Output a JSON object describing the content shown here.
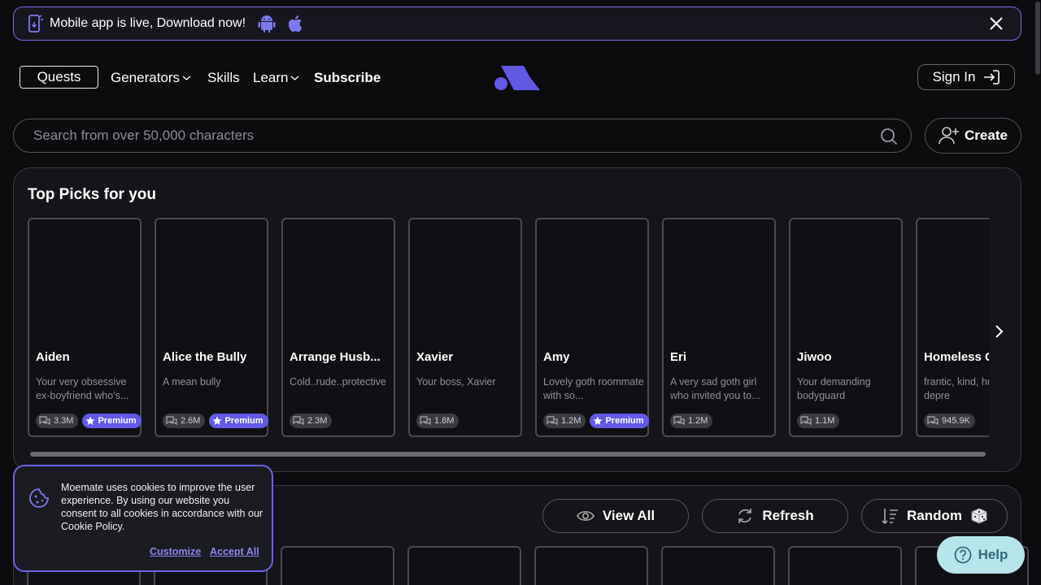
{
  "banner": {
    "text": "Mobile app is live, Download now!",
    "icons": [
      "phone-icon",
      "android-icon",
      "apple-icon",
      "close-icon"
    ]
  },
  "nav": {
    "quests": "Quests",
    "generators": "Generators",
    "skills": "Skills",
    "learn": "Learn",
    "subscribe": "Subscribe",
    "sign_in": "Sign In"
  },
  "search": {
    "placeholder": "Search from over 50,000 characters",
    "create_label": "Create"
  },
  "top_picks": {
    "title": "Top Picks for you",
    "premium_label": "Premium",
    "cards": [
      {
        "name": "Aiden",
        "desc": "Your very obsessive ex-boyfriend who's...",
        "count": "3.3M",
        "premium": true
      },
      {
        "name": "Alice the Bully",
        "desc": "A mean bully",
        "count": "2.6M",
        "premium": true
      },
      {
        "name": "Arrange Husb...",
        "desc": "Cold..rude..protective",
        "count": "2.3M",
        "premium": false
      },
      {
        "name": "Xavier",
        "desc": "Your boss, Xavier",
        "count": "1.8M",
        "premium": false
      },
      {
        "name": "Amy",
        "desc": "Lovely goth roommate with so...",
        "count": "1.2M",
        "premium": true
      },
      {
        "name": "Eri",
        "desc": "A very sad goth girl who invited you to...",
        "count": "1.2M",
        "premium": false
      },
      {
        "name": "Jiwoo",
        "desc": "Your demanding bodyguard",
        "count": "1.1M",
        "premium": false
      },
      {
        "name": "Homeless G",
        "desc": "frantic, kind, humble, depre",
        "count": "945.9K",
        "premium": false
      }
    ]
  },
  "actions": {
    "view_all": "View All",
    "refresh": "Refresh",
    "random": "Random"
  },
  "cookie": {
    "text": "Moemate uses cookies to improve the user experience. By using our website you consent to all cookies in accordance with our Cookie Policy.",
    "customize": "Customize",
    "accept_all": "Accept All"
  },
  "help": {
    "label": "Help"
  },
  "colors": {
    "accent": "#6259e8",
    "border_accent": "#7470ea",
    "help_bg": "#b7e5ec"
  }
}
